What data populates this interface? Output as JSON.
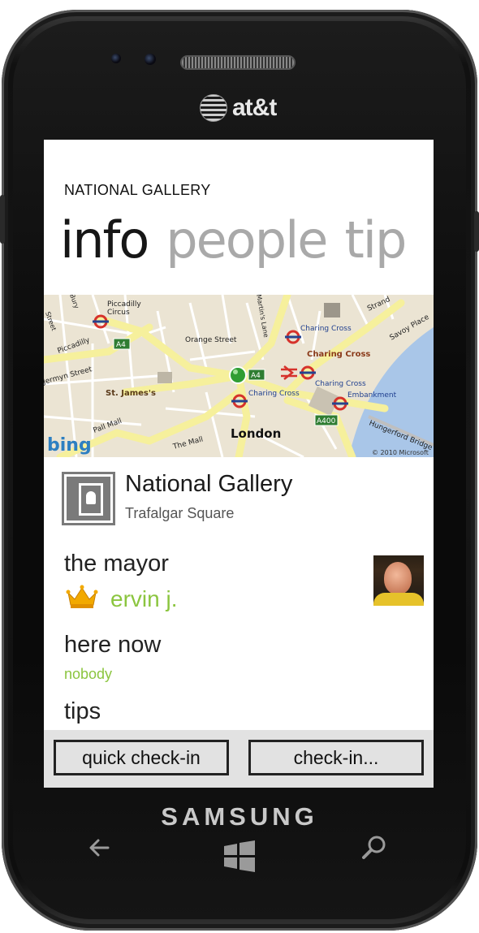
{
  "device": {
    "carrier": "at&t",
    "brand": "SAMSUNG",
    "hardware_buttons": [
      "back-icon",
      "windows-start-icon",
      "search-icon"
    ]
  },
  "app": {
    "title": "NATIONAL GALLERY",
    "pivot": [
      {
        "label": "info",
        "active": true
      },
      {
        "label": "people",
        "active": false
      },
      {
        "label": "tip",
        "active": false
      }
    ]
  },
  "map": {
    "provider": "bing",
    "copyright": "© 2010 Microsoft",
    "labels": {
      "piccadilly_circus_1": "Piccadilly",
      "piccadilly_circus_2": "Circus",
      "piccadilly": "Piccadilly",
      "jermyn_street": "Jermyn Street",
      "orange_street": "Orange Street",
      "charing_cross_1": "Charing Cross",
      "charing_cross_2": "Charing Cross",
      "charing_cross_3": "Charing Cross",
      "charing_cross_4": "Charing Cross",
      "strand": "Strand",
      "savoy_place": "Savoy Place",
      "embankment": "Embankment",
      "st_james": "St. James's",
      "pall_mall": "Pall Mall",
      "the_mall": "The Mall",
      "london": "London",
      "hungerford_bridge": "Hungerford Bridge",
      "a4_1": "A4",
      "a4_2": "A4",
      "a400": "A400",
      "martins_lane": "Martin's Lane",
      "street_left": "Street",
      "bury": "Bury"
    }
  },
  "venue": {
    "name": "National Gallery",
    "address": "Trafalgar Square",
    "icon": "picture-frame-icon"
  },
  "mayor": {
    "heading": "the mayor",
    "name": "ervin j.",
    "icon": "crown-icon"
  },
  "here_now": {
    "heading": "here now",
    "value": "nobody"
  },
  "tips": {
    "heading": "tips"
  },
  "appbar": {
    "quick_checkin": "quick check-in",
    "checkin": "check-in..."
  },
  "colors": {
    "accent": "#8bc53f",
    "pivot_inactive": "#a9a9a9",
    "appbar_bg": "#e2e2e2"
  }
}
